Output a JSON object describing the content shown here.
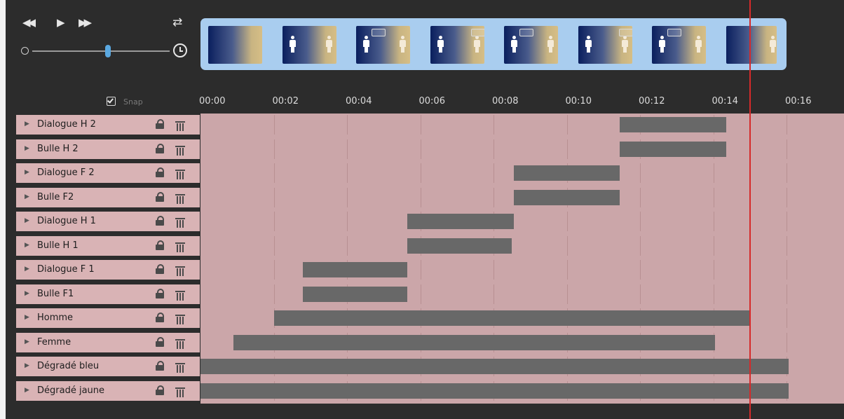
{
  "transport": {
    "rewind_icon": "fast-rewind-icon",
    "play_icon": "play-icon",
    "forward_icon": "fast-forward-icon",
    "loop_icon": "loop-icon",
    "speed_min_icon": "slow-clock-icon",
    "speed_max_icon": "clock-icon",
    "speed_level": 0.55
  },
  "filmstrip": {
    "thumbnails": [
      {
        "figures": 0,
        "bubble": false
      },
      {
        "figures": 2,
        "bubble": false
      },
      {
        "figures": 2,
        "bubble": true
      },
      {
        "figures": 2,
        "bubble": true
      },
      {
        "figures": 2,
        "bubble": true
      },
      {
        "figures": 2,
        "bubble": true
      },
      {
        "figures": 2,
        "bubble": true
      },
      {
        "figures": 1,
        "bubble": false
      }
    ]
  },
  "snap": {
    "label": "Snap",
    "checked": true
  },
  "ruler": {
    "ticks": [
      "00:00",
      "00:02",
      "00:04",
      "00:06",
      "00:08",
      "00:10",
      "00:12",
      "00:14",
      "00:16"
    ]
  },
  "playhead": {
    "time": 15.0
  },
  "colors": {
    "panel": "#2c2c2c",
    "label_bg": "#d9b3b5",
    "lane_bg": "#cba6a9",
    "clip": "#686868",
    "playhead": "#d62a2a",
    "film_frame": "#a9cdef"
  },
  "tracks": [
    {
      "name": "Dialogue H 2",
      "start": 11.45,
      "end": 14.35
    },
    {
      "name": "Bulle H 2",
      "start": 11.45,
      "end": 14.35
    },
    {
      "name": "Dialogue F 2",
      "start": 8.55,
      "end": 11.45
    },
    {
      "name": "Bulle F2",
      "start": 8.55,
      "end": 11.45
    },
    {
      "name": "Dialogue H 1",
      "start": 5.65,
      "end": 8.55
    },
    {
      "name": "Bulle H 1",
      "start": 5.65,
      "end": 8.5
    },
    {
      "name": "Dialogue F 1",
      "start": 2.8,
      "end": 5.65
    },
    {
      "name": "Bulle F1",
      "start": 2.8,
      "end": 5.65
    },
    {
      "name": "Homme",
      "start": 2.0,
      "end": 15.0
    },
    {
      "name": "Femme",
      "start": 0.9,
      "end": 14.05
    },
    {
      "name": "Dégradé bleu",
      "start": 0.0,
      "end": 16.05
    },
    {
      "name": "Dégradé jaune",
      "start": 0.0,
      "end": 16.05
    }
  ]
}
